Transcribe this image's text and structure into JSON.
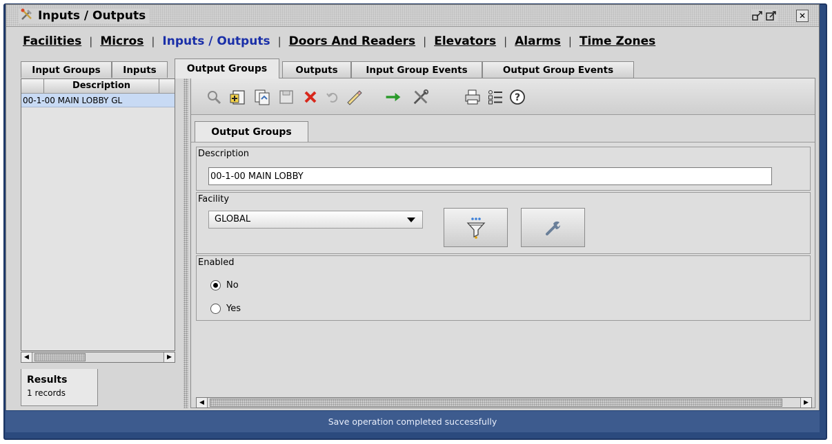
{
  "window": {
    "title": "Inputs / Outputs",
    "icon": "tools-icon",
    "controls": [
      "restore-icon",
      "maximize-icon",
      "close-icon"
    ]
  },
  "nav": {
    "facilities": "Facilities",
    "micros": "Micros",
    "inputs_outputs": "Inputs / Outputs",
    "doors_readers": "Doors And Readers",
    "elevators": "Elevators",
    "alarms": "Alarms",
    "time_zones": "Time Zones",
    "separator": "|"
  },
  "tabs": {
    "input_groups": "Input Groups",
    "inputs": "Inputs",
    "output_groups": "Output Groups",
    "outputs": "Outputs",
    "input_group_events": "Input Group Events",
    "output_group_events": "Output Group Events",
    "active": "Output Groups"
  },
  "results": {
    "column_description": "Description",
    "rows": [
      "00-1-00 MAIN LOBBY GL"
    ],
    "tab_label": "Results",
    "count": "1 records"
  },
  "toolbar": {
    "icons": [
      "search-icon",
      "add-icon",
      "copy-icon",
      "save-icon",
      "delete-icon",
      "undo-icon",
      "edit-icon",
      "go-icon",
      "tools-icon",
      "print-icon",
      "list-icon",
      "help-icon"
    ],
    "accent_delete": "#d8281c",
    "accent_go": "#2a9a2a"
  },
  "form": {
    "inner_tab": "Output Groups",
    "description_label": "Description",
    "description_value": "00-1-00 MAIN LOBBY",
    "facility_label": "Facility",
    "facility_value": "GLOBAL",
    "filter_button_icon": "filter-icon",
    "wrench_button_icon": "wrench-icon",
    "enabled_label": "Enabled",
    "enabled_no": "No",
    "enabled_yes": "Yes",
    "enabled_selected": "No"
  },
  "status": {
    "message": "Save operation completed successfully",
    "bar_color": "#3d5b8e"
  }
}
